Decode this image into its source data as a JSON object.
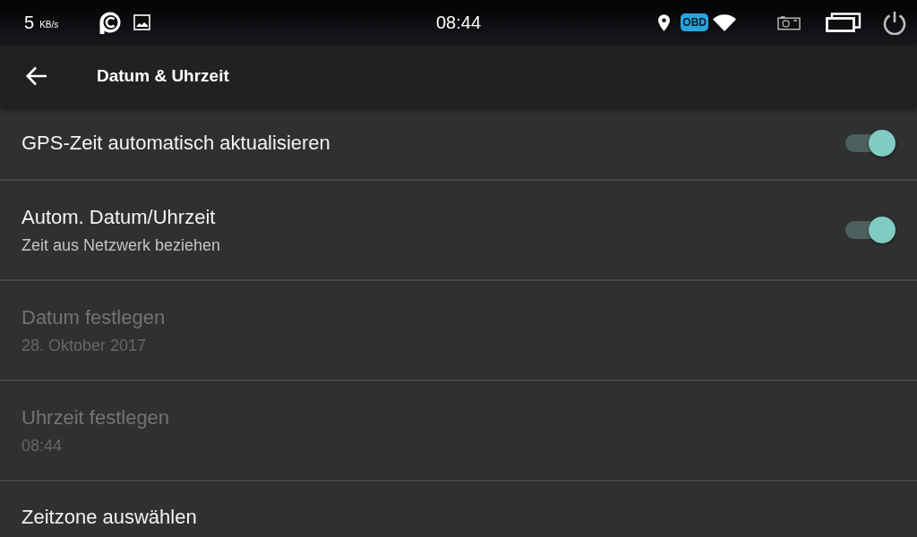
{
  "status_bar": {
    "speed_value": "5",
    "speed_unit": "KB/s",
    "time": "08:44",
    "obd_label": "OBD"
  },
  "app_bar": {
    "title": "Datum & Uhrzeit"
  },
  "settings": [
    {
      "kind": "switch",
      "title": "GPS-Zeit automatisch aktualisieren",
      "on": true,
      "disabled": false
    },
    {
      "kind": "switch",
      "title": "Autom. Datum/Uhrzeit",
      "summary": "Zeit aus Netzwerk beziehen",
      "on": true,
      "disabled": false
    },
    {
      "kind": "plain",
      "title": "Datum festlegen",
      "summary": "28. Oktober 2017",
      "disabled": true
    },
    {
      "kind": "plain",
      "title": "Uhrzeit festlegen",
      "summary": "08:44",
      "disabled": true
    },
    {
      "kind": "plain",
      "title": "Zeitzone auswählen",
      "disabled": false
    }
  ]
}
